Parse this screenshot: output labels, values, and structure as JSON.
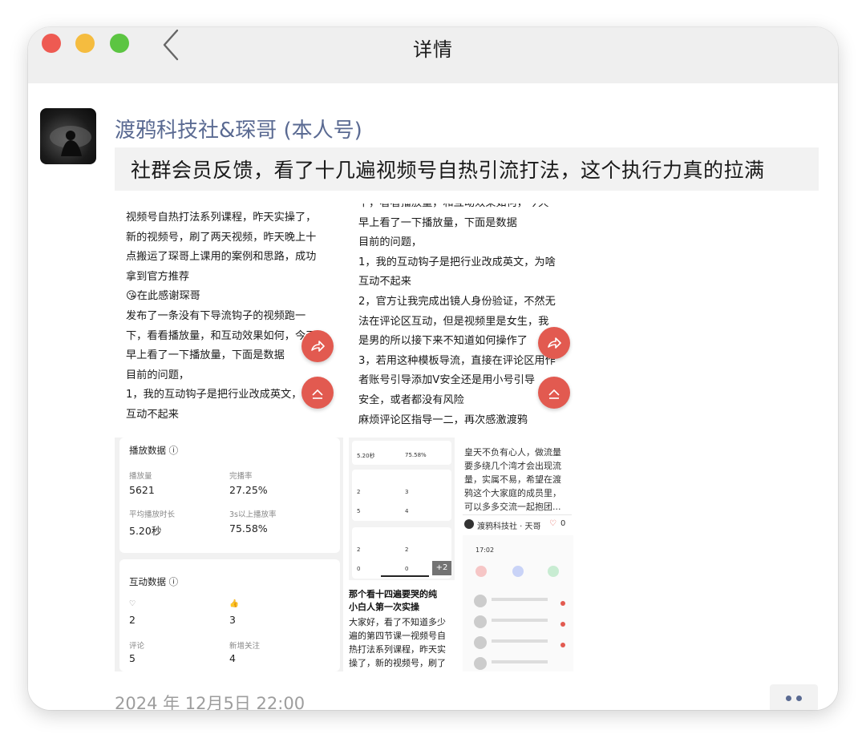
{
  "window": {
    "title": "详情"
  },
  "post": {
    "author": "渡鸦科技社&琛哥 (本人号)",
    "text": "社群会员反馈，看了十几遍视频号自热引流打法，这个执行力真的拉满",
    "timestamp": "2024 年 12月5日 22:00"
  },
  "shot1": {
    "text": "视频号自热打法系列课程，昨天实操了，\n新的视频号，刷了两天视频，昨天晚上十\n点搬运了琛哥上课用的案例和思路，成功\n拿到官方推荐\n😘在此感谢琛哥\n发布了一条没有下导流钩子的视频跑一\n下，看看播放量，和互动效果如何，今天\n早上看了一下播放量，下面是数据\n目前的问题，\n1，我的互动钩子是把行业改成英文，为啥\n互动不起来"
  },
  "shot2": {
    "text": "下，看看播放量，和互动效果如何，今天\n早上看了一下播放量，下面是数据\n目前的问题，\n1，我的互动钩子是把行业改成英文，为啥\n互动不起来\n2，官方让我完成出镜人身份验证，不然无\n法在评论区互动，但是视频里是女生，我\n是男的所以接下来不知道如何操作了\n3，若用这种模板导流，直接在评论区用作\n者账号引导添加V安全还是用小号引导\n安全，或者都没有风险\n麻烦评论区指导一二，再次感激渡鸦"
  },
  "stats": {
    "play_title": "播放数据",
    "play_items": [
      {
        "label": "播放量",
        "value": "5621"
      },
      {
        "label": "完播率",
        "value": "27.25%"
      },
      {
        "label": "平均播放时长",
        "value": "5.20秒"
      },
      {
        "label": "3s以上播放率",
        "value": "75.58%"
      }
    ],
    "interact_title": "互动数据",
    "interact_items": [
      {
        "label": "♡",
        "value": "2"
      },
      {
        "label": "👍",
        "value": "3"
      },
      {
        "label": "评论",
        "value": "5"
      },
      {
        "label": "新增关注",
        "value": "4"
      }
    ]
  },
  "grid": {
    "mini_values": [
      "5.20秒",
      "75.58%",
      "2",
      "3",
      "5",
      "4",
      "2",
      "2",
      "0",
      "0"
    ],
    "badge": "+2",
    "caption": "那个看十四遍要哭的纯\n小白人第一次实操",
    "body": "大家好，看了不知道多少\n遍的第四节课一视频号自\n热打法系列课程，昨天实\n操了，新的视频号，刷了\n两天视频，昨天晚上十点",
    "comment": "皇天不负有心人，做流量\n要多绕几个湾才会出现流\n量，实属不易，希望在渡\n鸦这个大家庭的成员里，\n可以多多交流一起抱团...",
    "comment_author": "渡鸦科技社 · 天哥",
    "like_count": "0",
    "phone_time": "17:02"
  }
}
